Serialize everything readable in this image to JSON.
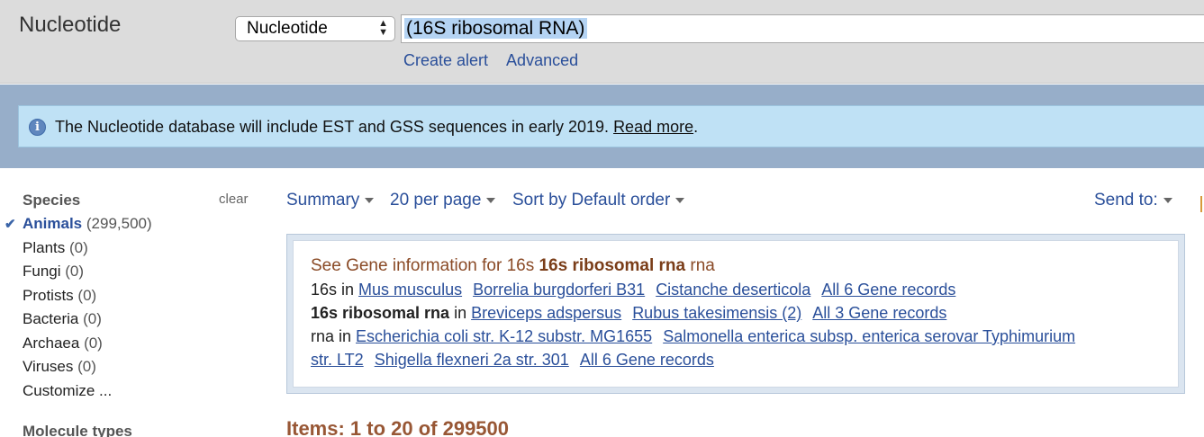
{
  "header": {
    "app_title": "Nucleotide",
    "database_select": {
      "selected": "Nucleotide"
    },
    "search": {
      "value": "(16S ribosomal RNA)"
    },
    "links": {
      "create_alert": "Create alert",
      "advanced": "Advanced"
    }
  },
  "notice": {
    "text": "The Nucleotide database will include EST and GSS sequences in early 2019.",
    "link": "Read more",
    "tail": ".",
    "icon": "info-icon"
  },
  "sidebar": {
    "species_title": "Species",
    "clear_label": "clear",
    "items": [
      {
        "label": "Animals",
        "count": "(299,500)",
        "active": true
      },
      {
        "label": "Plants",
        "count": "(0)"
      },
      {
        "label": "Fungi",
        "count": "(0)"
      },
      {
        "label": "Protists",
        "count": "(0)"
      },
      {
        "label": "Bacteria",
        "count": "(0)"
      },
      {
        "label": "Archaea",
        "count": "(0)"
      },
      {
        "label": "Viruses",
        "count": "(0)"
      },
      {
        "label": "Customize ...",
        "count": ""
      }
    ],
    "molecule_title": "Molecule types"
  },
  "toolbar": {
    "summary": "Summary",
    "per_page": "20 per page",
    "sort": "Sort by Default order",
    "send_to": "Send to:"
  },
  "gene_box": {
    "head_prefix": "See Gene information for 16s ",
    "head_bold": "16s ribosomal rna",
    "head_suffix": " rna",
    "row1": {
      "term": "16s",
      "in": " in ",
      "links": [
        "Mus musculus",
        "Borrelia burgdorferi B31",
        "Cistanche deserticola",
        "All 6 Gene records"
      ]
    },
    "row2": {
      "term": "16s ribosomal rna",
      "in": " in ",
      "links": [
        "Breviceps adspersus",
        "Rubus takesimensis (2)",
        "All 3 Gene records"
      ]
    },
    "row3": {
      "term": "rna",
      "in": " in ",
      "links": [
        "Escherichia coli str. K-12 substr. MG1655",
        "Salmonella enterica subsp. enterica serovar Typhimurium",
        "str. LT2",
        "Shigella flexneri 2a str. 301",
        "All 6 Gene records"
      ]
    }
  },
  "results": {
    "items_count": "Items: 1 to 20 of 299500"
  },
  "colors": {
    "link": "#2a4f9a",
    "band": "#97aec9",
    "notice_bg": "#bfe1f5",
    "items_count": "#985735"
  }
}
